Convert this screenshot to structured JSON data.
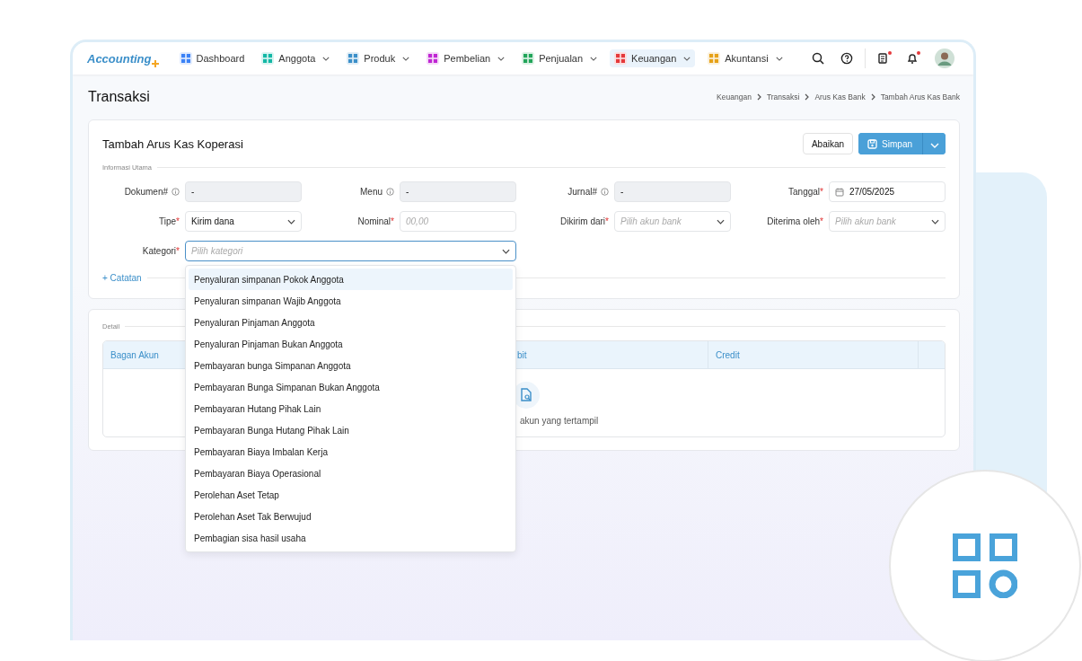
{
  "logo": {
    "text": "Accounting"
  },
  "nav": [
    {
      "label": "Dashboard",
      "color": "#3b82f6",
      "dropdown": false,
      "selected": false
    },
    {
      "label": "Anggota",
      "color": "#14b8a6",
      "dropdown": true,
      "selected": false
    },
    {
      "label": "Produk",
      "color": "#3b8fc9",
      "dropdown": true,
      "selected": false
    },
    {
      "label": "Pembelian",
      "color": "#c026d3",
      "dropdown": true,
      "selected": false
    },
    {
      "label": "Penjualan",
      "color": "#22a55a",
      "dropdown": true,
      "selected": false
    },
    {
      "label": "Keuangan",
      "color": "#e5393b",
      "dropdown": true,
      "selected": true
    },
    {
      "label": "Akuntansi",
      "color": "#e6a117",
      "dropdown": true,
      "selected": false
    }
  ],
  "header_icons": [
    {
      "kind": "search",
      "alert": false
    },
    {
      "kind": "help",
      "alert": false
    },
    {
      "kind": "document",
      "alert": true
    },
    {
      "kind": "bell",
      "alert": true
    },
    {
      "kind": "avatar",
      "alert": false
    }
  ],
  "page_title": "Transaksi",
  "breadcrumb": [
    "Keuangan",
    "Transaksi",
    "Arus Kas Bank",
    "Tambah Arus Kas Bank"
  ],
  "form": {
    "title": "Tambah Arus Kas Koperasi",
    "cancel_button": "Abaikan",
    "save_button": "Simpan",
    "section": "Informasi Utama",
    "fields": [
      {
        "label": "Dokumen#",
        "kind": "readonly",
        "value": "-",
        "required": false,
        "info": true
      },
      {
        "label": "Menu",
        "kind": "readonly",
        "value": "-",
        "required": false,
        "info": true
      },
      {
        "label": "Jurnal#",
        "kind": "readonly",
        "value": "-",
        "required": false,
        "info": true
      },
      {
        "label": "Tanggal",
        "kind": "date",
        "value": "27/05/2025",
        "required": true,
        "info": false
      },
      {
        "label": "Tipe",
        "kind": "select",
        "value": "Kirim dana",
        "required": true,
        "info": false
      },
      {
        "label": "Nominal",
        "kind": "input",
        "placeholder": "00,00",
        "required": true,
        "info": false
      },
      {
        "label": "Dikirim dari",
        "kind": "select",
        "placeholder": "Pilih akun bank",
        "required": true,
        "info": false
      },
      {
        "label": "Diterima oleh",
        "kind": "select",
        "placeholder": "Pilih akun bank",
        "required": true,
        "info": false
      },
      {
        "label": "Kategori",
        "kind": "select",
        "placeholder": "Pilih kategori",
        "required": true,
        "info": false,
        "wide": true,
        "expanded": true
      }
    ],
    "notes_link": "+ Catatan",
    "required_mark": "*"
  },
  "category_options": [
    {
      "label": "Penyaluran simpanan Pokok Anggota",
      "selected": true
    },
    {
      "label": "Penyaluran simpanan Wajib Anggota",
      "selected": false
    },
    {
      "label": "Penyaluran Pinjaman Anggota",
      "selected": false
    },
    {
      "label": "Penyaluran Pinjaman Bukan Anggota",
      "selected": false
    },
    {
      "label": "Pembayaran bunga Simpanan Anggota",
      "selected": false
    },
    {
      "label": "Pembayaran Bunga Simpanan Bukan Anggota",
      "selected": false
    },
    {
      "label": "Pembayaran Hutang Pihak Lain",
      "selected": false
    },
    {
      "label": "Pembayaran Bunga Hutang Pihak Lain",
      "selected": false
    },
    {
      "label": "Pembayaran Biaya Imbalan Kerja",
      "selected": false
    },
    {
      "label": "Pembayaran Biaya Operasional",
      "selected": false
    },
    {
      "label": "Perolehan Aset Tetap",
      "selected": false
    },
    {
      "label": "Perolehan Aset Tak Berwujud",
      "selected": false
    },
    {
      "label": "Pembagian sisa hasil usaha",
      "selected": false
    }
  ],
  "detail": {
    "section": "Detail",
    "columns": [
      "Bagan Akun",
      "bit",
      "Credit"
    ],
    "empty_text": "akun yang tertampil"
  }
}
